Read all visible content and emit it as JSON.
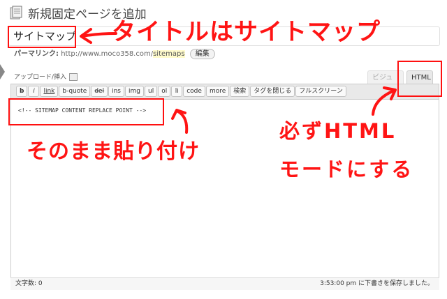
{
  "page": {
    "title": "新規固定ページを追加",
    "page_icon": "pages-icon"
  },
  "post_title": {
    "value": "サイトマップ"
  },
  "permalink": {
    "label": "パーマリンク:",
    "base_url": "http://www.moco358.com/",
    "slug": "sitemaps",
    "edit_label": "編集"
  },
  "upload": {
    "label": "アップロード/挿入",
    "icon": "media-icon"
  },
  "editor_tabs": {
    "visual": "ビジュアル",
    "html": "HTML",
    "active": "html"
  },
  "toolbar": {
    "buttons": [
      "b",
      "i",
      "link",
      "b-quote",
      "del",
      "ins",
      "img",
      "ul",
      "ol",
      "li",
      "code",
      "more",
      "検索",
      "タグを閉じる",
      "フルスクリーン"
    ]
  },
  "editor": {
    "content": "<!-- SITEMAP CONTENT REPLACE POINT -->"
  },
  "statusbar": {
    "word_count": "文字数: 0",
    "draft_saved": "3:53:00 pm に下書きを保存しました。"
  },
  "annotations": {
    "title_note": "タイトルはサイトマップ",
    "paste_note": "そのまま貼り付け",
    "html_note_line1": "必ずHTML",
    "html_note_line2": "モードにする",
    "color": "#ff1414"
  }
}
